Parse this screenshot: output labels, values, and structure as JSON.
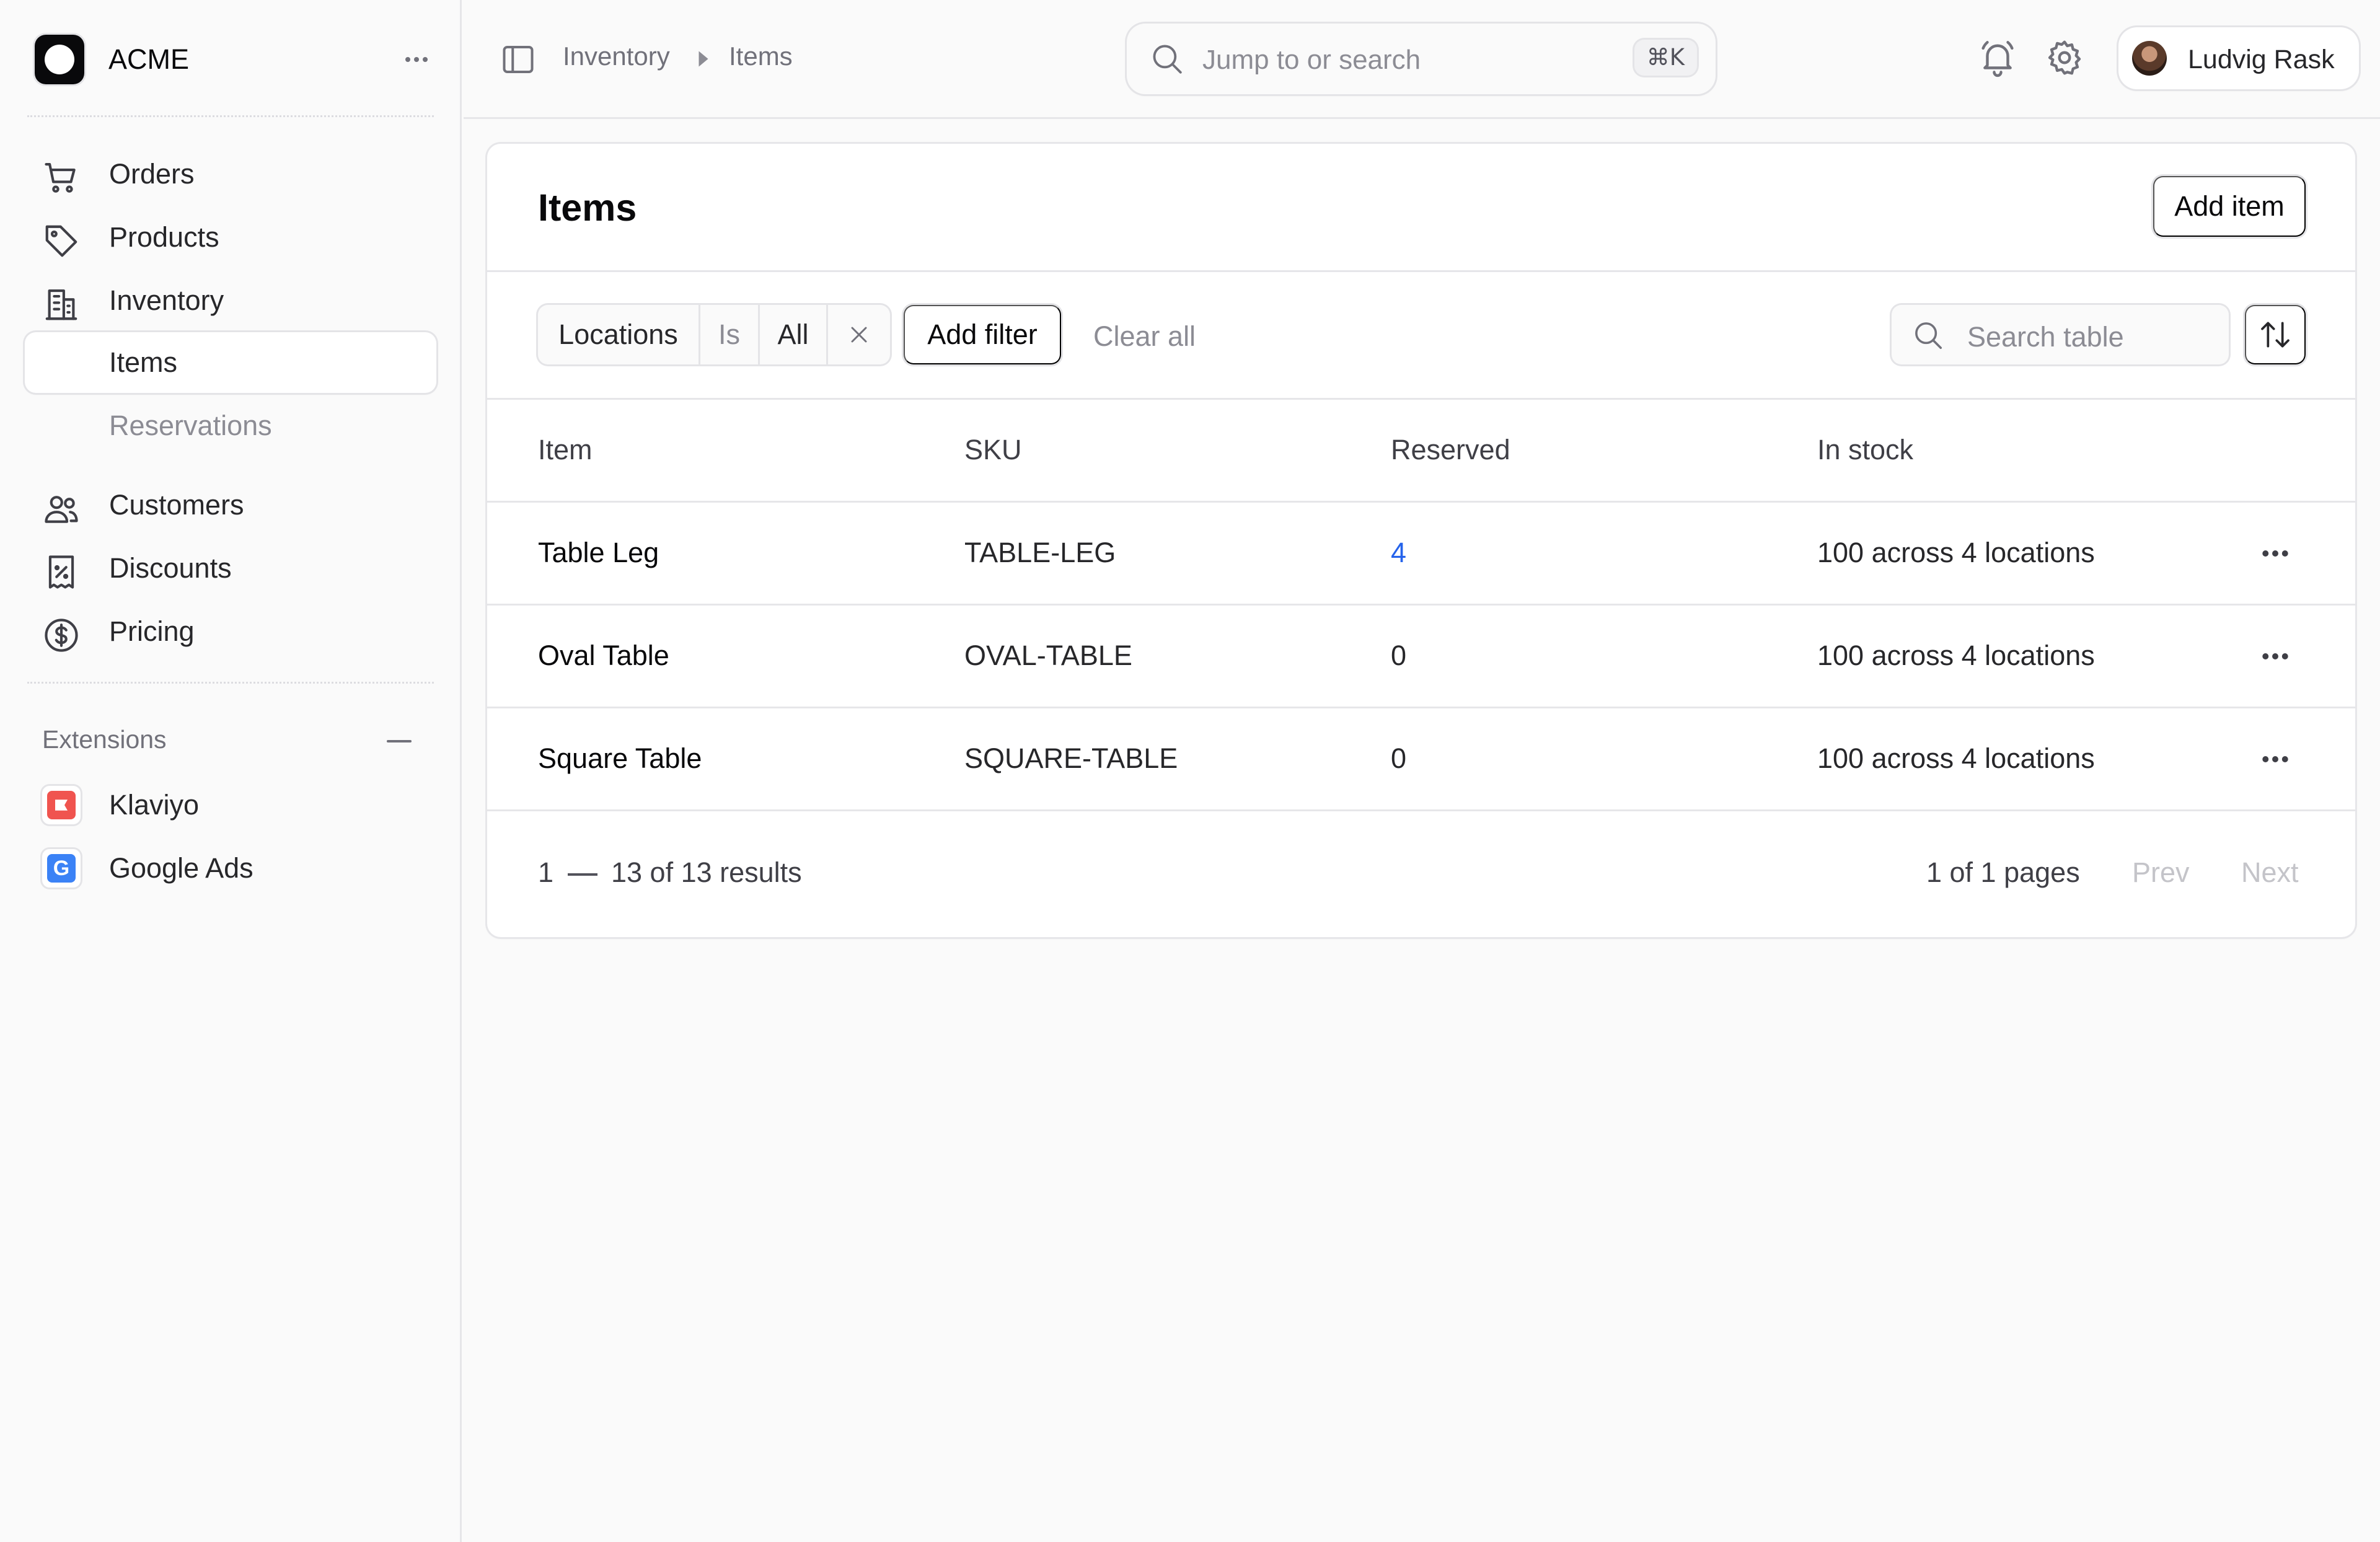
{
  "brand": {
    "name": "ACME"
  },
  "nav": {
    "orders": "Orders",
    "products": "Products",
    "inventory": "Inventory",
    "items": "Items",
    "reservations": "Reservations",
    "customers": "Customers",
    "discounts": "Discounts",
    "pricing": "Pricing"
  },
  "extensions": {
    "title": "Extensions",
    "klaviyo": "Klaviyo",
    "google_ads": "Google Ads",
    "google_ads_glyph": "G"
  },
  "topbar": {
    "breadcrumb_parent": "Inventory",
    "breadcrumb_current": "Items",
    "search_placeholder": "Jump to or search",
    "search_shortcut": "⌘K",
    "user_name": "Ludvig Rask"
  },
  "page": {
    "title": "Items",
    "add_button": "Add item"
  },
  "filters": {
    "field": "Locations",
    "operator": "Is",
    "value": "All",
    "add_filter": "Add filter",
    "clear_all": "Clear all",
    "search_placeholder": "Search table"
  },
  "table": {
    "columns": [
      "Item",
      "SKU",
      "Reserved",
      "In stock"
    ],
    "rows": [
      {
        "item": "Table Leg",
        "sku": "TABLE-LEG",
        "reserved": "4",
        "in_stock": "100 across 4 locations"
      },
      {
        "item": "Oval Table",
        "sku": "OVAL-TABLE",
        "reserved": "0",
        "in_stock": "100 across 4 locations"
      },
      {
        "item": "Square Table",
        "sku": "SQUARE-TABLE",
        "reserved": "0",
        "in_stock": "100 across 4 locations"
      }
    ]
  },
  "pagination": {
    "range_start": "1",
    "range_end": "13 of 13 results",
    "pages": "1 of 1 pages",
    "prev": "Prev",
    "next": "Next"
  },
  "colors": {
    "link": "#2563eb",
    "klaviyo": "#f0544f",
    "google_ads": "#3b82f6"
  }
}
